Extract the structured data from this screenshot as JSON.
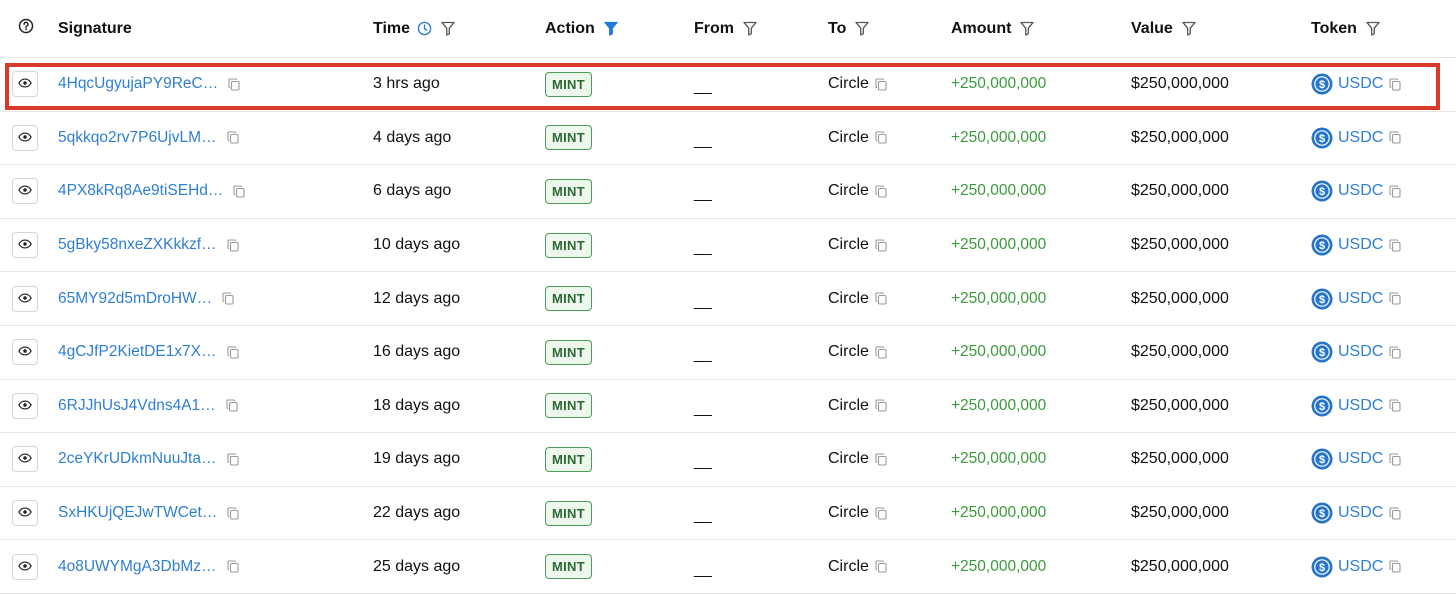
{
  "columns": {
    "signature": "Signature",
    "time": "Time",
    "action": "Action",
    "from": "From",
    "to": "To",
    "amount": "Amount",
    "value": "Value",
    "token": "Token"
  },
  "colors": {
    "link": "#2f7fd1",
    "positive": "#3c9a3c",
    "badge_border": "#4c9a55",
    "highlight": "#d9392b",
    "filter_active": "#1f7ae0"
  },
  "icons": {
    "header_help": "help-circle-icon",
    "row_view": "eye-icon",
    "copy": "copy-icon",
    "filter": "filter-icon",
    "time_sort": "clock-icon",
    "token_logo": "usdc-coin-icon"
  },
  "rows": [
    {
      "signature": "4HqcUgyujaPY9ReC…",
      "time": "3 hrs ago",
      "action": "MINT",
      "from": "__",
      "to": "Circle",
      "amount": "+250,000,000",
      "value": "$250,000,000",
      "token": "USDC"
    },
    {
      "signature": "5qkkqo2rv7P6UjvLM…",
      "time": "4 days ago",
      "action": "MINT",
      "from": "__",
      "to": "Circle",
      "amount": "+250,000,000",
      "value": "$250,000,000",
      "token": "USDC"
    },
    {
      "signature": "4PX8kRq8Ae9tiSEHd…",
      "time": "6 days ago",
      "action": "MINT",
      "from": "__",
      "to": "Circle",
      "amount": "+250,000,000",
      "value": "$250,000,000",
      "token": "USDC"
    },
    {
      "signature": "5gBky58nxeZXKkkzf…",
      "time": "10 days ago",
      "action": "MINT",
      "from": "__",
      "to": "Circle",
      "amount": "+250,000,000",
      "value": "$250,000,000",
      "token": "USDC"
    },
    {
      "signature": "65MY92d5mDroHW…",
      "time": "12 days ago",
      "action": "MINT",
      "from": "__",
      "to": "Circle",
      "amount": "+250,000,000",
      "value": "$250,000,000",
      "token": "USDC"
    },
    {
      "signature": "4gCJfP2KietDE1x7X…",
      "time": "16 days ago",
      "action": "MINT",
      "from": "__",
      "to": "Circle",
      "amount": "+250,000,000",
      "value": "$250,000,000",
      "token": "USDC"
    },
    {
      "signature": "6RJJhUsJ4Vdns4A1…",
      "time": "18 days ago",
      "action": "MINT",
      "from": "__",
      "to": "Circle",
      "amount": "+250,000,000",
      "value": "$250,000,000",
      "token": "USDC"
    },
    {
      "signature": "2ceYKrUDkmNuuJta…",
      "time": "19 days ago",
      "action": "MINT",
      "from": "__",
      "to": "Circle",
      "amount": "+250,000,000",
      "value": "$250,000,000",
      "token": "USDC"
    },
    {
      "signature": "SxHKUjQEJwTWCet…",
      "time": "22 days ago",
      "action": "MINT",
      "from": "__",
      "to": "Circle",
      "amount": "+250,000,000",
      "value": "$250,000,000",
      "token": "USDC"
    },
    {
      "signature": "4o8UWYMgA3DbMz…",
      "time": "25 days ago",
      "action": "MINT",
      "from": "__",
      "to": "Circle",
      "amount": "+250,000,000",
      "value": "$250,000,000",
      "token": "USDC"
    }
  ]
}
